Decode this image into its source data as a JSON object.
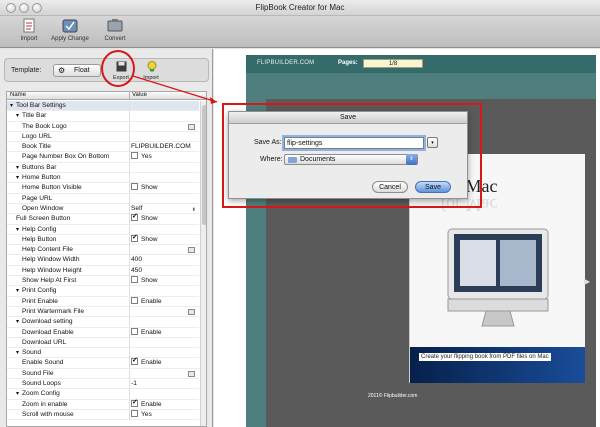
{
  "window": {
    "title": "FlipBook Creator for Mac"
  },
  "toolbar": {
    "items": [
      "Import",
      "Apply Change",
      "Convert"
    ]
  },
  "template_bar": {
    "label": "Template:",
    "selected": "Float",
    "export_label": "Export",
    "import_label": "Import"
  },
  "grid": {
    "headers": [
      "Name",
      "Value"
    ],
    "rows": [
      {
        "name": "Tool Bar Settings",
        "value": ""
      },
      {
        "name": "Title Bar",
        "value": ""
      },
      {
        "name": "The Book Logo",
        "value": ""
      },
      {
        "name": "Logo URL",
        "value": ""
      },
      {
        "name": "Book Title",
        "value": "FLIPBUILDER.COM"
      },
      {
        "name": "Page Number Box On Bottom",
        "value": "Yes"
      },
      {
        "name": "Buttons Bar",
        "value": ""
      },
      {
        "name": "Home Button",
        "value": ""
      },
      {
        "name": "Home Button Visible",
        "value": "Show"
      },
      {
        "name": "Page URL",
        "value": ""
      },
      {
        "name": "Open Window",
        "value": "Self"
      },
      {
        "name": "Full Screen Button",
        "value": "Show"
      },
      {
        "name": "Help Config",
        "value": ""
      },
      {
        "name": "Help Button",
        "value": "Show"
      },
      {
        "name": "Help Content File",
        "value": ""
      },
      {
        "name": "Help Window Width",
        "value": "400"
      },
      {
        "name": "Help Window Height",
        "value": "450"
      },
      {
        "name": "Show Help At First",
        "value": "Show"
      },
      {
        "name": "Print Config",
        "value": ""
      },
      {
        "name": "Print Enable",
        "value": "Enable"
      },
      {
        "name": "Print Wartermark File",
        "value": ""
      },
      {
        "name": "Download setting",
        "value": ""
      },
      {
        "name": "Download Enable",
        "value": "Enable"
      },
      {
        "name": "Download URL",
        "value": ""
      },
      {
        "name": "Sound",
        "value": ""
      },
      {
        "name": "Enable Sound",
        "value": "Enable"
      },
      {
        "name": "Sound File",
        "value": ""
      },
      {
        "name": "Sound Loops",
        "value": "-1"
      },
      {
        "name": "Zoom Config",
        "value": ""
      },
      {
        "name": "Zoom in enable",
        "value": "Enable"
      },
      {
        "name": "Scroll with mouse",
        "value": "Yes"
      }
    ]
  },
  "book": {
    "name": "FLIPBUILDER.COM",
    "pages_label": "Pages:",
    "page_value": "1/8",
    "cover_heading": "for Mac",
    "cover_caption": "Create your flipping book from PDF files on Mac",
    "cover_copyright": "2011© Flipbuilder.com"
  },
  "dialog": {
    "title": "Save",
    "save_as_label": "Save As:",
    "save_as_value": "flip-settings",
    "where_label": "Where:",
    "where_value": "Documents",
    "cancel_label": "Cancel",
    "save_label": "Save"
  },
  "colors": {
    "accent_red": "#d81818",
    "book_teal": "#4e7e7d",
    "button_blue": "#5f95dd"
  }
}
